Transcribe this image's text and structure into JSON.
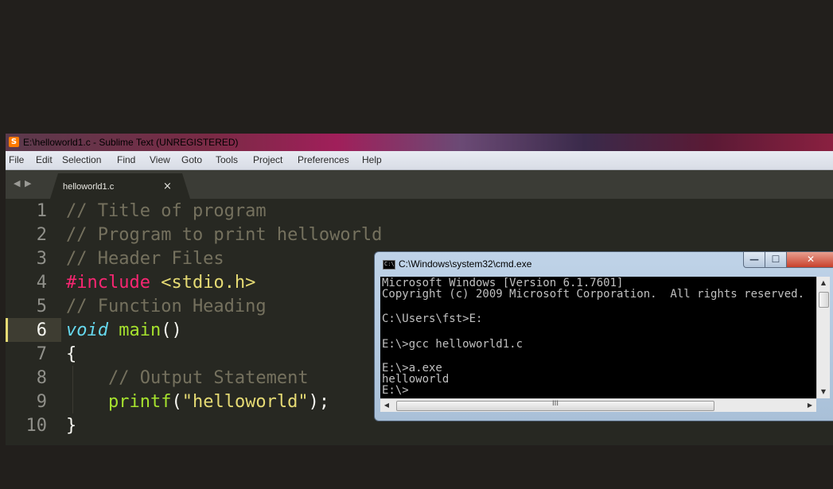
{
  "sublime": {
    "title": "E:\\helloworld1.c - Sublime Text (UNREGISTERED)",
    "logo_glyph": "S",
    "menu": [
      "File",
      "Edit",
      "Selection",
      "Find",
      "View",
      "Goto",
      "Tools",
      "Project",
      "Preferences",
      "Help"
    ],
    "tab_nav": "◀ ▶",
    "tab": {
      "name": "helloworld1.c",
      "close": "×"
    },
    "current_line": 6,
    "lines": [
      {
        "n": "1",
        "parts": [
          {
            "t": "// Title of program",
            "c": "comment"
          }
        ]
      },
      {
        "n": "2",
        "parts": [
          {
            "t": "// Program to print helloworld",
            "c": "comment"
          }
        ]
      },
      {
        "n": "3",
        "parts": [
          {
            "t": "// Header Files",
            "c": "comment"
          }
        ]
      },
      {
        "n": "4",
        "parts": [
          {
            "t": "#include",
            "c": "kw"
          },
          {
            "t": " ",
            "c": ""
          },
          {
            "t": "<stdio.h>",
            "c": "str"
          }
        ]
      },
      {
        "n": "5",
        "parts": [
          {
            "t": "// Function Heading",
            "c": "comment"
          }
        ]
      },
      {
        "n": "6",
        "parts": [
          {
            "t": "void",
            "c": "type"
          },
          {
            "t": " ",
            "c": ""
          },
          {
            "t": "main",
            "c": "fn"
          },
          {
            "t": "()",
            "c": ""
          }
        ]
      },
      {
        "n": "7",
        "parts": [
          {
            "t": "{",
            "c": ""
          }
        ]
      },
      {
        "n": "8",
        "parts": [
          {
            "t": "    ",
            "c": ""
          },
          {
            "t": "// Output Statement",
            "c": "comment"
          }
        ]
      },
      {
        "n": "9",
        "parts": [
          {
            "t": "    ",
            "c": ""
          },
          {
            "t": "printf",
            "c": "fn"
          },
          {
            "t": "(",
            "c": ""
          },
          {
            "t": "\"helloworld\"",
            "c": "str"
          },
          {
            "t": ");",
            "c": ""
          }
        ]
      },
      {
        "n": "10",
        "parts": [
          {
            "t": "}",
            "c": ""
          }
        ]
      }
    ],
    "colors": {
      "background": "#272822",
      "comment": "#75715e",
      "keyword": "#f92672",
      "string": "#e6db74",
      "type": "#66d9ef",
      "function": "#a6e22e"
    }
  },
  "cmd": {
    "title": "C:\\Windows\\system32\\cmd.exe",
    "icon_glyph": "C:\\",
    "buttons": {
      "minimize": "—",
      "maximize": "☐",
      "close": "✕"
    },
    "scroll_grip": "III",
    "output": [
      "Microsoft Windows [Version 6.1.7601]",
      "Copyright (c) 2009 Microsoft Corporation.  All rights reserved.",
      "",
      "C:\\Users\\fst>E:",
      "",
      "E:\\>gcc helloworld1.c",
      "",
      "E:\\>a.exe",
      "helloworld",
      "E:\\>"
    ]
  }
}
